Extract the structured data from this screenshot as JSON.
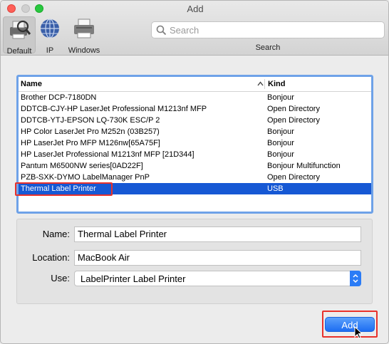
{
  "window": {
    "title": "Add"
  },
  "toolbar": {
    "tools": [
      {
        "label": "Default",
        "icon": "default-printer-icon"
      },
      {
        "label": "IP",
        "icon": "globe-icon"
      },
      {
        "label": "Windows",
        "icon": "windows-printer-icon"
      }
    ],
    "search": {
      "placeholder": "Search",
      "caption": "Search"
    }
  },
  "printer_list": {
    "columns": {
      "name": "Name",
      "kind": "Kind"
    },
    "rows": [
      {
        "name": "Brother DCP-7180DN",
        "kind": "Bonjour"
      },
      {
        "name": "DDTCB-CJY-HP LaserJet Professional M1213nf MFP",
        "kind": "Open Directory"
      },
      {
        "name": "DDTCB-YTJ-EPSON LQ-730K ESC/P 2",
        "kind": "Open Directory"
      },
      {
        "name": "HP Color LaserJet Pro M252n (03B257)",
        "kind": "Bonjour"
      },
      {
        "name": "HP LaserJet Pro MFP M126nw[65A75F]",
        "kind": "Bonjour"
      },
      {
        "name": "HP LaserJet Professional M1213nf MFP [21D344]",
        "kind": "Bonjour"
      },
      {
        "name": "Pantum M6500NW series[0AD22F]",
        "kind": "Bonjour Multifunction"
      },
      {
        "name": "PZB-SXK-DYMO LabelManager PnP",
        "kind": "Open Directory"
      },
      {
        "name": "Thermal Label Printer",
        "kind": "USB"
      }
    ],
    "selected_index": 8
  },
  "details": {
    "name_label": "Name:",
    "name_value": "Thermal Label Printer",
    "location_label": "Location:",
    "location_value": "MacBook Air",
    "use_label": "Use:",
    "use_value": "LabelPrinter Label Printer"
  },
  "actions": {
    "add_label": "Add"
  },
  "colors": {
    "selection": "#1658d4",
    "accent": "#2b7cf6",
    "highlight": "#e8312b"
  }
}
